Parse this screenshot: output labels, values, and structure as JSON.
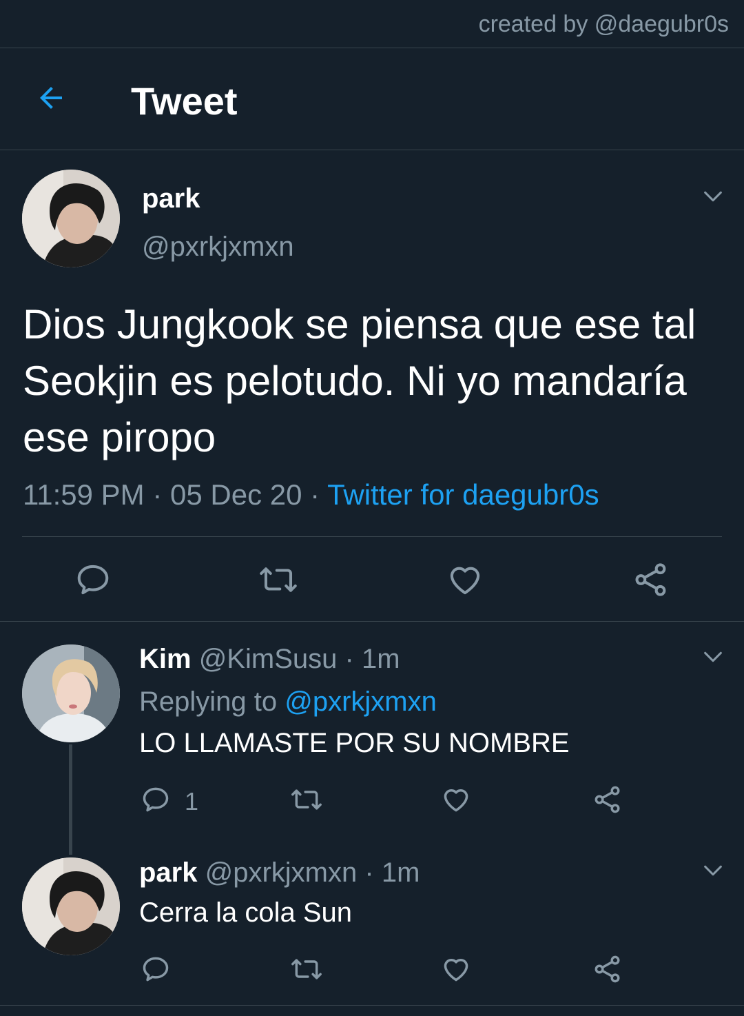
{
  "credit": "created by @daegubr0s",
  "header": {
    "title": "Tweet"
  },
  "tweet": {
    "name": "park",
    "handle": "@pxrkjxmxn",
    "text": "Dios Jungkook se piensa que ese tal Seokjin es pelotudo. Ni yo mandaría ese piropo",
    "time": "11:59 PM",
    "sep": "·",
    "date": "05 Dec 20",
    "source": "Twitter for daegubr0s"
  },
  "replies": [
    {
      "name": "Kim",
      "handle": "@KimSusu",
      "time": "1m",
      "sep": "·",
      "replying_label": "Replying to",
      "replying_to": "@pxrkjxmxn",
      "text": "LO LLAMASTE POR SU NOMBRE",
      "reply_count": "1"
    },
    {
      "name": "park",
      "handle": "@pxrkjxmxn",
      "time": "1m",
      "sep": "·",
      "text": "Cerra la cola Sun"
    }
  ],
  "colors": {
    "background": "#15202b",
    "accent": "#1da1f2",
    "muted": "#8899a6",
    "divider": "#38444d"
  },
  "icons": [
    "back-arrow-icon",
    "chevron-down-icon",
    "reply-icon",
    "retweet-icon",
    "like-icon",
    "share-icon"
  ]
}
